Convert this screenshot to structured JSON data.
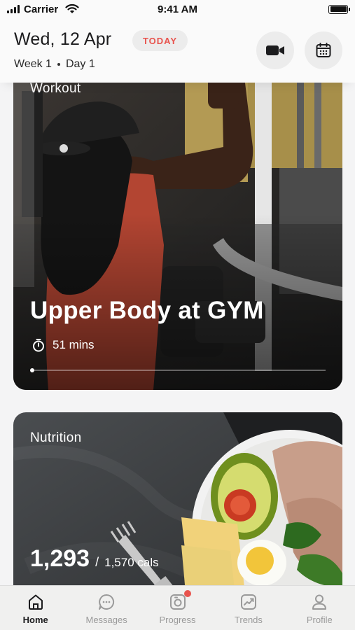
{
  "status_bar": {
    "carrier": "Carrier",
    "time": "9:41 AM"
  },
  "header": {
    "date": "Wed, 12 Apr",
    "today_badge": "TODAY",
    "week": "Week 1",
    "day": "Day 1",
    "video_icon": "video-camera-icon",
    "calendar_icon": "calendar-icon"
  },
  "workout_card": {
    "label": "Workout",
    "title": "Upper Body at GYM",
    "duration": "51 mins",
    "progress": 0.0
  },
  "nutrition_card": {
    "label": "Nutrition",
    "calories_consumed": "1,293",
    "separator": "/",
    "calories_target": "1,570 cals"
  },
  "tabs": [
    {
      "label": "Home",
      "icon": "home-icon",
      "active": true
    },
    {
      "label": "Messages",
      "icon": "chat-icon",
      "active": false
    },
    {
      "label": "Progress",
      "icon": "camera-icon",
      "active": false,
      "notification": true
    },
    {
      "label": "Trends",
      "icon": "trend-chart-icon",
      "active": false
    },
    {
      "label": "Profile",
      "icon": "person-icon",
      "active": false
    }
  ],
  "colors": {
    "accent": "#e8544e",
    "active_tab": "#1c1c1e",
    "inactive_tab": "#9a9a9a"
  }
}
